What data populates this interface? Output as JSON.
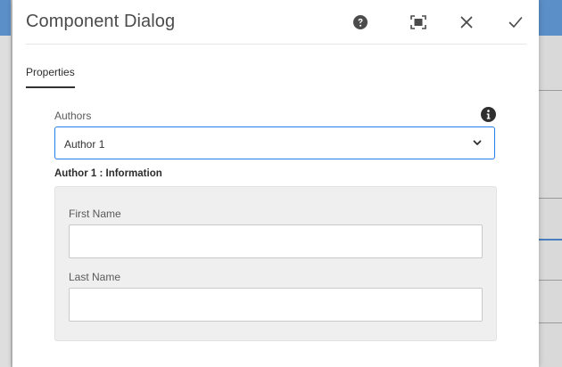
{
  "dialog": {
    "title": "Component Dialog",
    "header_buttons": [
      {
        "name": "help",
        "icon": "help-circle-icon"
      },
      {
        "name": "fullscreen",
        "icon": "fullscreen-icon"
      },
      {
        "name": "close",
        "icon": "close-icon"
      },
      {
        "name": "done",
        "icon": "checkmark-icon"
      }
    ]
  },
  "tabs": [
    {
      "label": "Properties",
      "active": true
    }
  ],
  "authors_field": {
    "label": "Authors",
    "selected": "Author 1",
    "info_icon": "info-icon"
  },
  "author_section": {
    "title": "Author 1 : Information",
    "first_name": {
      "label": "First Name",
      "value": "",
      "placeholder": ""
    },
    "last_name": {
      "label": "Last Name",
      "value": "",
      "placeholder": ""
    }
  },
  "colors": {
    "accent": "#2680eb",
    "title_text": "#4b4b4b",
    "panel_bg": "#efefef"
  }
}
